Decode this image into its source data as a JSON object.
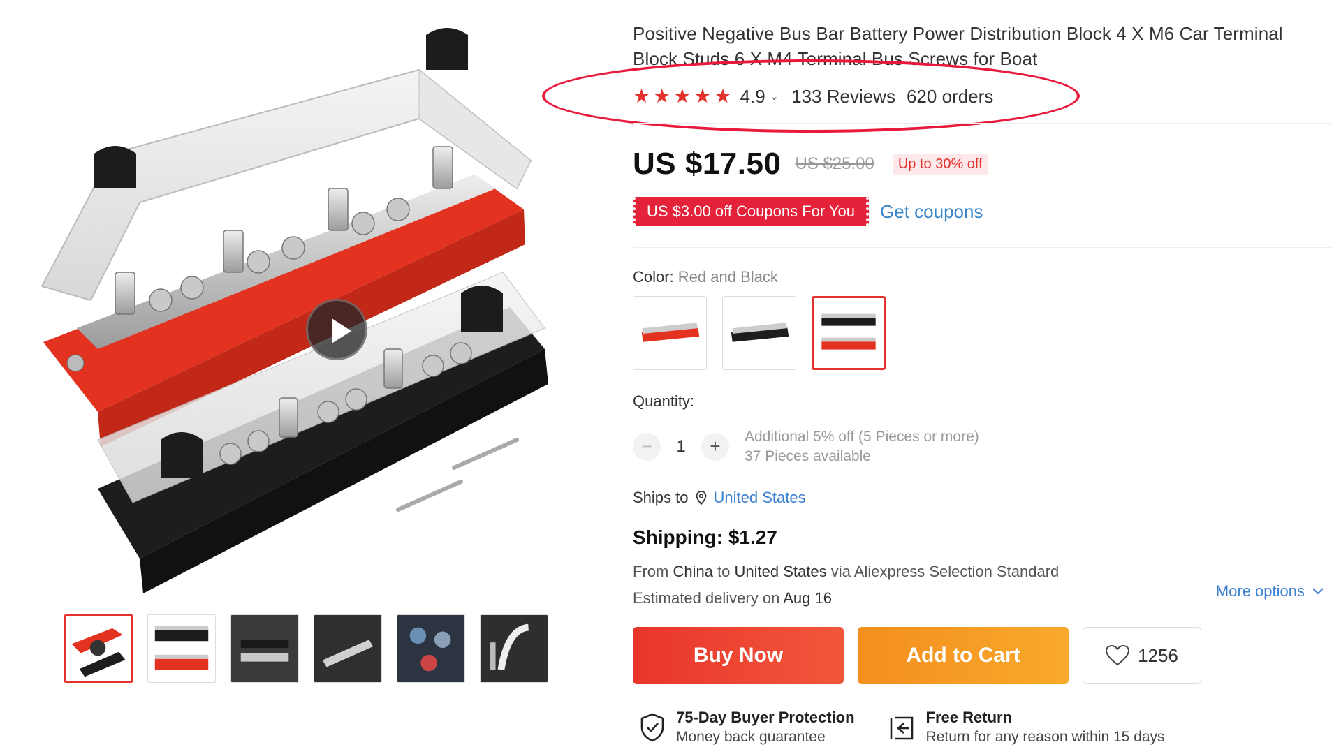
{
  "product": {
    "title": "Positive Negative Bus Bar Battery Power Distribution Block 4 X M6 Car Terminal Block Studs 6 X M4 Terminal Bus Screws for Boat",
    "rating": "4.9",
    "reviews": "133 Reviews",
    "orders": "620 orders",
    "stars_filled": 5
  },
  "price": {
    "current": "US $17.50",
    "original": "US $25.00",
    "discount": "Up to 30% off"
  },
  "coupon": {
    "badge": "US $3.00 off Coupons For You",
    "link": "Get coupons"
  },
  "color": {
    "label": "Color: ",
    "selected": "Red and Black",
    "options": [
      "Red",
      "Black",
      "Red and Black"
    ]
  },
  "quantity": {
    "label": "Quantity:",
    "value": "1",
    "minus": "−",
    "plus": "+",
    "note_discount": "Additional 5% off (5 Pieces or more)",
    "note_available": "37 Pieces available"
  },
  "shipping": {
    "ships_to_label": "Ships to",
    "country": "United States",
    "title": "Shipping: $1.27",
    "from_prefix": "From",
    "from_country": "China",
    "to_prefix": "to",
    "to_country": "United States",
    "via": "via Aliexpress Selection Standard",
    "estimate_prefix": "Estimated delivery on",
    "estimate_date": "Aug 16",
    "more_options": "More options"
  },
  "actions": {
    "buy_now": "Buy Now",
    "add_to_cart": "Add to Cart",
    "wishlist_count": "1256"
  },
  "guarantees": {
    "protection_title": "75-Day Buyer Protection",
    "protection_sub": "Money back guarantee",
    "return_title": "Free Return",
    "return_sub": "Return for any reason within 15 days"
  },
  "colors": {
    "accent": "#e4312b",
    "link": "#3a7fd0",
    "annotation": "#e8193a",
    "cart": "#f8a92b"
  },
  "icons": [
    "play-icon",
    "star-icon",
    "chevron-down-icon",
    "location-pin-icon",
    "heart-icon",
    "shield-check-icon",
    "return-icon"
  ]
}
